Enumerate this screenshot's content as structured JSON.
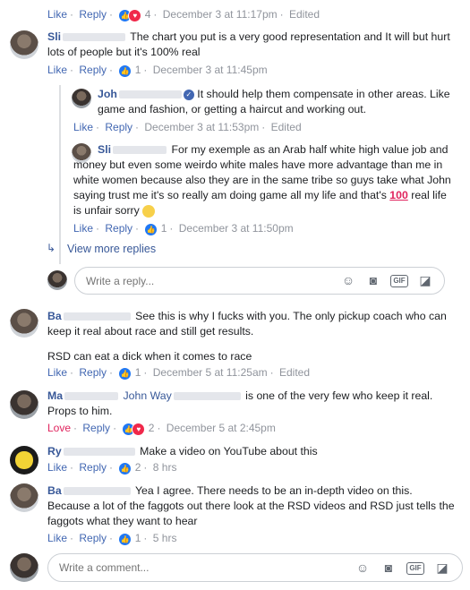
{
  "comments": [
    {
      "actions": {
        "like": "Like",
        "reply": "Reply",
        "count": "4",
        "time": "December 3 at 11:17pm",
        "edited": "Edited"
      }
    },
    {
      "author": "Sli",
      "text": "The chart you put is a very good representation and It will but hurt lots of people but it's 100% real",
      "actions": {
        "like": "Like",
        "reply": "Reply",
        "count": "1",
        "time": "December 3 at 11:45pm"
      }
    },
    {
      "author": "Joh",
      "text": "It should help them compensate in other areas. Like game and fashion, or getting a haircut and working out.",
      "actions": {
        "like": "Like",
        "reply": "Reply",
        "time": "December 3 at 11:53pm",
        "edited": "Edited"
      }
    },
    {
      "author": "Sli",
      "text": "For my exemple as an Arab half white high value job and money but even some weirdo white males have more advantage than me in white women because also they are in the same tribe so guys take what John saying trust me it's so really am doing game all my life and that's",
      "text_end": "real life is unfair sorry",
      "actions": {
        "like": "Like",
        "reply": "Reply",
        "count": "1",
        "time": "December 3 at 11:50pm"
      }
    },
    {
      "author": "Ba",
      "text": "See this is why I fucks with you. The only pickup coach who can keep it real about race and still get results.",
      "text2": "RSD can eat a dick when it comes to race",
      "actions": {
        "like": "Like",
        "reply": "Reply",
        "count": "1",
        "time": "December 5 at 11:25am",
        "edited": "Edited"
      }
    },
    {
      "author": "Ma",
      "mention": "John Way",
      "text": "is one of the very few who keep it real. Props to him.",
      "actions": {
        "like": "Love",
        "reply": "Reply",
        "count": "2",
        "time": "December 5 at 2:45pm"
      }
    },
    {
      "author": "Ry",
      "text": "Make a video on YouTube about this",
      "actions": {
        "like": "Like",
        "reply": "Reply",
        "count": "2",
        "time": "8 hrs"
      }
    },
    {
      "author": "Ba",
      "text": "Yea I agree. There needs to be an in-depth video on this. Because a lot of the faggots out there look at the RSD videos and RSD just tells the faggots what they want to hear",
      "actions": {
        "like": "Like",
        "reply": "Reply",
        "count": "1",
        "time": "5 hrs"
      }
    }
  ],
  "view_more": "View more replies",
  "reply_input": {
    "placeholder": "Write a reply..."
  },
  "comment_input": {
    "placeholder": "Write a comment..."
  },
  "icons": {
    "emoji": "smile-icon",
    "camera": "camera-icon",
    "gif": "GIF",
    "sticker": "sticker-icon"
  },
  "colors": {
    "link": "#385898",
    "action": "#4267b2",
    "love": "#e0245e"
  }
}
